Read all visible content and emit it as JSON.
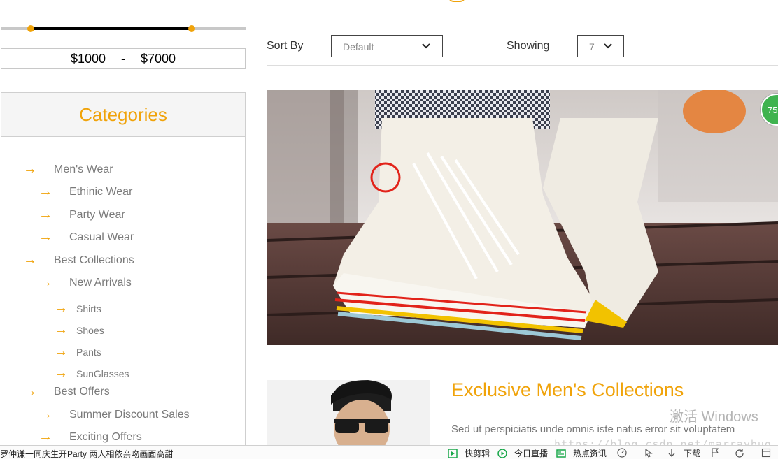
{
  "price_filter": {
    "min": "$1000",
    "separator": "-",
    "max": "$7000",
    "range_fraction": [
      0.12,
      0.78
    ]
  },
  "categories": {
    "title": "Categories",
    "items": [
      {
        "label": "Men's Wear",
        "level": 0
      },
      {
        "label": "Ethinic Wear",
        "level": 1
      },
      {
        "label": "Party Wear",
        "level": 1
      },
      {
        "label": "Casual Wear",
        "level": 1
      },
      {
        "label": "Best Collections",
        "level": 0
      },
      {
        "label": "New Arrivals",
        "level": 1
      },
      {
        "label": "Shirts",
        "level": 2
      },
      {
        "label": "Shoes",
        "level": 2
      },
      {
        "label": "Pants",
        "level": 2
      },
      {
        "label": "SunGlasses",
        "level": 2
      },
      {
        "label": "Best Offers",
        "level": 0
      },
      {
        "label": "Summer Discount Sales",
        "level": 1
      },
      {
        "label": "Exciting Offers",
        "level": 1
      }
    ]
  },
  "toolbar": {
    "sort_label": "Sort By",
    "sort_value": "Default",
    "showing_label": "Showing",
    "showing_value": "7"
  },
  "badge": {
    "text": "75"
  },
  "product": {
    "title": "Exclusive Men's Collections",
    "description": "Sed ut perspiciatis unde omnis iste natus error sit voluptatem"
  },
  "overlay": {
    "watermark": "激活 Windows",
    "url": "https://blog.csdn.net/marraybug"
  },
  "statusbar": {
    "news": "罗仲谦一同庆生开Party 两人相依亲吻画面高甜",
    "items": [
      "快剪辑",
      "今日直播",
      "热点资讯",
      "下载"
    ]
  },
  "colors": {
    "accent": "#f0a30a",
    "badge": "#3fb34f"
  }
}
